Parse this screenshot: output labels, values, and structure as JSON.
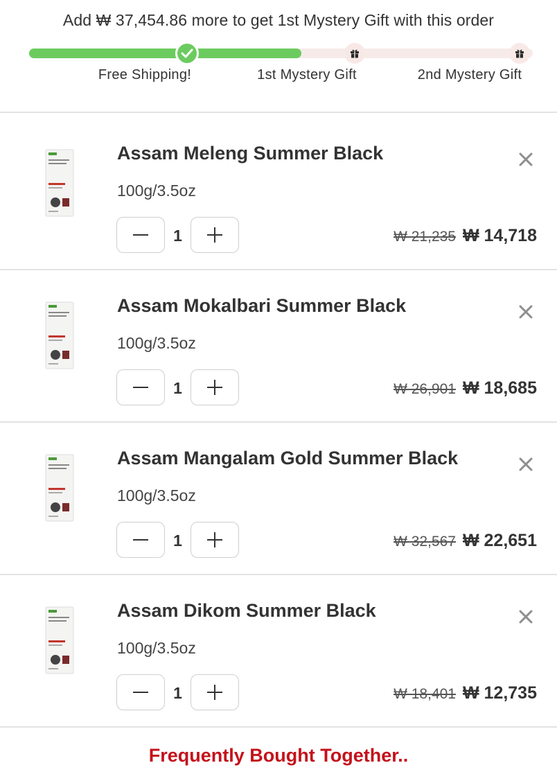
{
  "progress": {
    "message": "Add ₩ 37,454.86 more to get 1st Mystery Gift with this order",
    "fill_fraction": 0.54,
    "accent_color": "#6ccb5f",
    "milestones": [
      {
        "label": "Free Shipping!",
        "icon": "check-icon",
        "reached": true
      },
      {
        "label": "1st Mystery Gift",
        "icon": "gift-icon",
        "reached": false
      },
      {
        "label": "2nd Mystery Gift",
        "icon": "gift-icon",
        "reached": false
      }
    ]
  },
  "cart": {
    "items": [
      {
        "name": "Assam Meleng Summer Black",
        "variant": "100g/3.5oz",
        "quantity": "1",
        "old_price": "₩ 21,235",
        "price": "₩ 14,718"
      },
      {
        "name": "Assam Mokalbari Summer Black",
        "variant": "100g/3.5oz",
        "quantity": "1",
        "old_price": "₩ 26,901",
        "price": "₩ 18,685"
      },
      {
        "name": "Assam Mangalam Gold Summer Black",
        "variant": "100g/3.5oz",
        "quantity": "1",
        "old_price": "₩ 32,567",
        "price": "₩ 22,651"
      },
      {
        "name": "Assam Dikom Summer Black",
        "variant": "100g/3.5oz",
        "quantity": "1",
        "old_price": "₩ 18,401",
        "price": "₩ 12,735"
      }
    ]
  },
  "recommendations": {
    "heading": "Frequently Bought Together..",
    "heading_color": "#c4121a"
  }
}
